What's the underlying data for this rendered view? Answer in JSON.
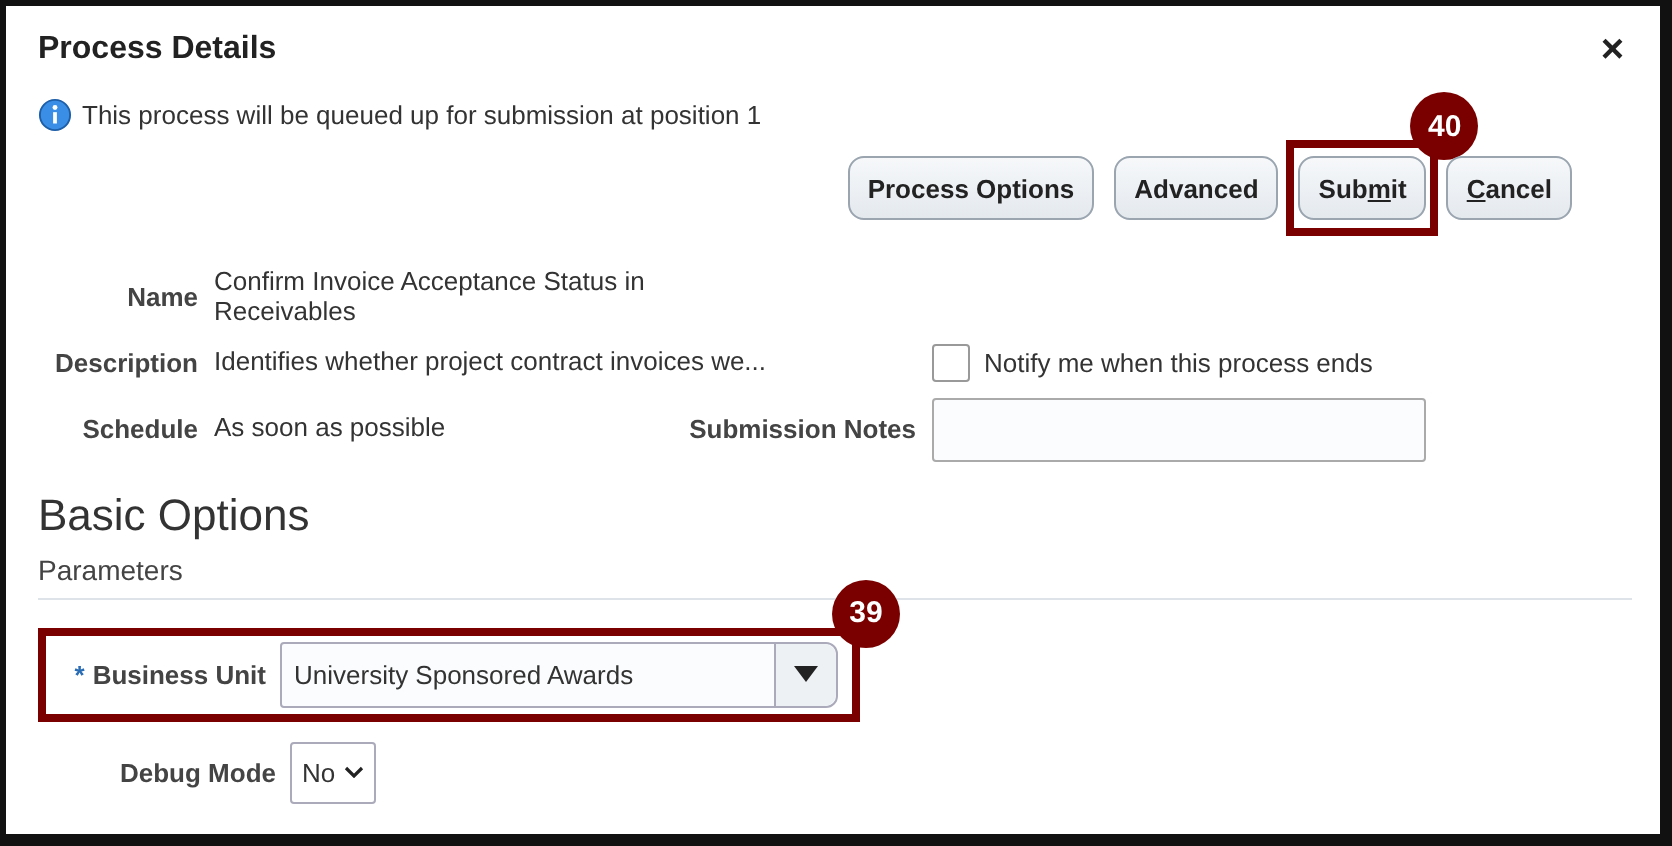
{
  "dialog": {
    "title": "Process Details",
    "close": "×"
  },
  "info_message": "This process will be queued up for submission at position 1",
  "buttons": [
    {
      "label_parts": [
        {
          "text": "Process Options"
        }
      ]
    },
    {
      "label_parts": [
        {
          "text": "Advanced"
        }
      ]
    },
    {
      "label_parts": [
        {
          "text": "Sub"
        },
        {
          "text": "m",
          "underlined": true
        },
        {
          "text": "it"
        }
      ],
      "callout": "40"
    },
    {
      "label_parts": [
        {
          "text": "C",
          "underlined": true
        },
        {
          "text": "ancel"
        }
      ]
    }
  ],
  "details": {
    "name_label": "Name",
    "name": "Confirm Invoice Acceptance Status in Receivables",
    "description_label": "Description",
    "description": "Identifies whether project contract invoices we...",
    "schedule_label": "Schedule",
    "schedule": "As soon as possible"
  },
  "notify": {
    "label": "Notify me when this process ends",
    "checked": false
  },
  "submission_notes": {
    "label": "Submission Notes"
  },
  "section": {
    "title": "Basic Options",
    "subtitle": "Parameters"
  },
  "parameters": [
    {
      "kind": "combo",
      "required": true,
      "required_mark": "*",
      "label": "Business Unit",
      "value": "University Sponsored Awards",
      "callout": "39"
    },
    {
      "kind": "select",
      "label": "Debug Mode",
      "value": "No"
    }
  ]
}
